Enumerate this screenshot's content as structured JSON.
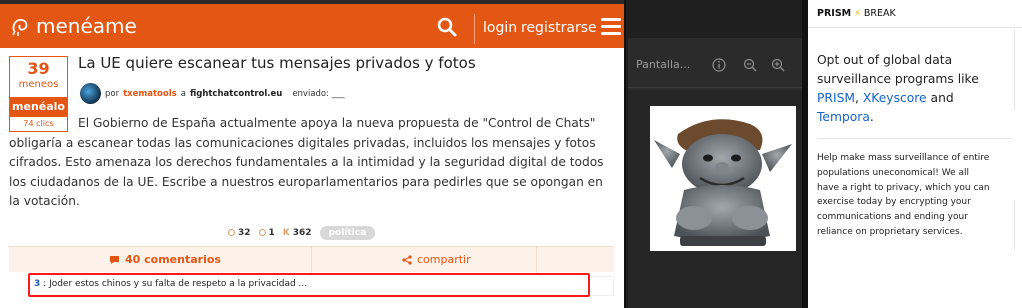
{
  "meneame": {
    "logo_text": "menéame",
    "login_label": "login",
    "register_label": "registrarse",
    "colors": {
      "brand": "#e35614",
      "comment_highlight": "#ff1a1a"
    },
    "story": {
      "votes": "39",
      "votes_label": "meneos",
      "vote_button_label": "menéalo",
      "clicks": "74 clics",
      "title": "La UE quiere escanear tus mensajes privados y fotos",
      "meta_prefix": "por",
      "author": "txematools",
      "meta_a": "a",
      "domain": "fightchatcontrol.eu",
      "sent_label": "enviado: ___",
      "body": "El Gobierno de España actualmente apoya la nueva propuesta de \"Control de Chats\" obligaría a escanear todas las comunicaciones digitales privadas, incluidos los mensajes y fotos cifrados. Esto amenaza los derechos fundamentales a la intimidad y la seguridad digital de todos los ciudadanos de la UE. Escribe a nuestros europarlamentarios para pedirles que se opongan en la votación.",
      "stat_positive": "32",
      "stat_negative": "1",
      "karma_label": "K",
      "karma": "362",
      "tag": "política",
      "comments_label": "40 comentarios",
      "share_label": "compartir"
    },
    "comment": {
      "number": "3",
      "separator": ":",
      "text": "Joder estos chinos y su falta de respeto a la privacidad ..."
    }
  },
  "viewer": {
    "title": "Pantalla...",
    "icons": [
      "info-icon",
      "zoom-out-icon",
      "zoom-in-icon"
    ]
  },
  "prism": {
    "brand_bold": "PRISM",
    "brand_bolt": "⚡",
    "brand_rest": "BREAK",
    "lead_text": "Opt out of global data surveillance programs like",
    "link1": "PRISM",
    "sep1": ",",
    "link2": "XKeyscore",
    "and_text": "and",
    "link3": "Tempora",
    "end": ".",
    "body": "Help make mass surveillance of entire populations uneconomical! We all have a right to privacy, which you can exercise today by encrypting your communications and ending your reliance on proprietary services."
  }
}
